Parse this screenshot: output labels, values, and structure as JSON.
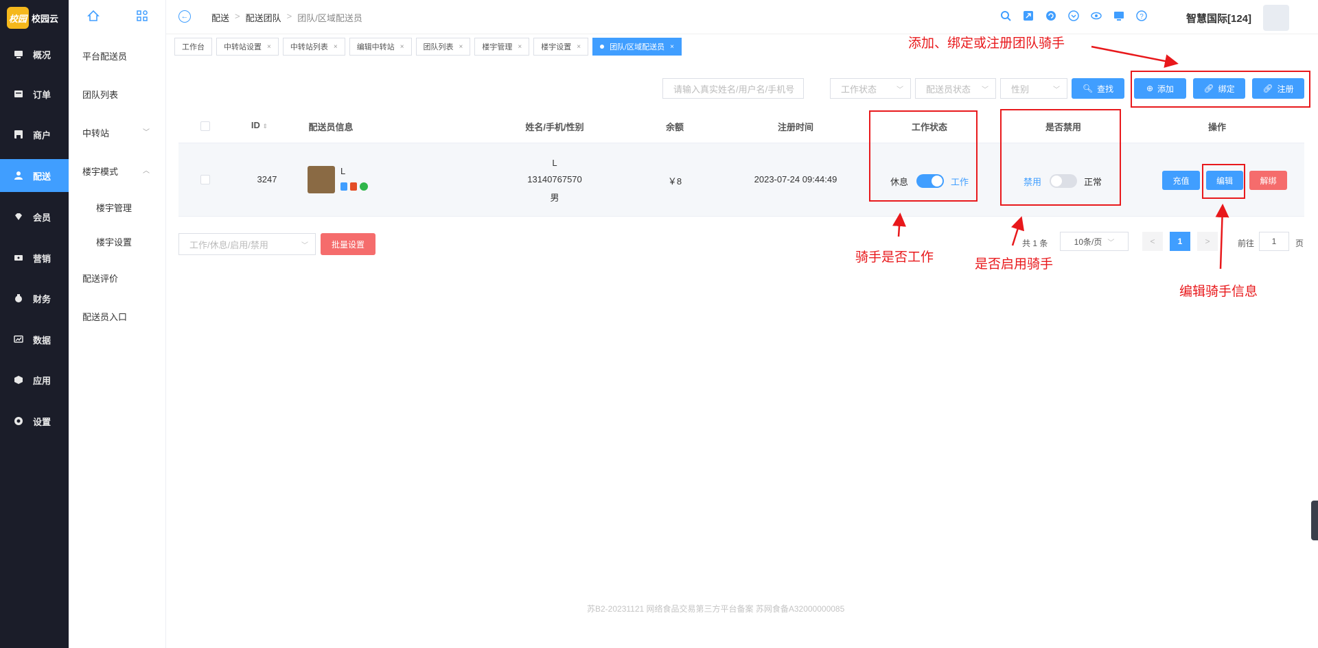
{
  "app": {
    "logo_badge": "校园",
    "logo_name": "校园云",
    "accent": "#409eff",
    "danger": "#f56c6c",
    "annotation_color": "#e8181b"
  },
  "sidebar": {
    "items": [
      {
        "label": "概况",
        "icon": "monitor-icon"
      },
      {
        "label": "订单",
        "icon": "order-icon"
      },
      {
        "label": "商户",
        "icon": "store-icon"
      },
      {
        "label": "配送",
        "icon": "rider-icon",
        "active": true
      },
      {
        "label": "会员",
        "icon": "diamond-icon"
      },
      {
        "label": "营销",
        "icon": "ticket-icon"
      },
      {
        "label": "财务",
        "icon": "money-bag-icon"
      },
      {
        "label": "数据",
        "icon": "chart-icon"
      },
      {
        "label": "应用",
        "icon": "cube-icon"
      },
      {
        "label": "设置",
        "icon": "settings-icon"
      }
    ]
  },
  "submenu": {
    "items": [
      "平台配送员",
      "团队列表",
      "中转站",
      "楼宇模式",
      "楼宇管理",
      "楼宇设置",
      "配送评价",
      "配送员入口"
    ]
  },
  "header": {
    "breadcrumb": [
      "配送",
      "配送团队",
      "团队/区域配送员"
    ],
    "org_name": "智慧国际[124]"
  },
  "tabs": [
    "工作台",
    "中转站设置",
    "中转站列表",
    "编辑中转站",
    "团队列表",
    "楼宇管理",
    "楼宇设置",
    "团队/区域配送员"
  ],
  "filters": {
    "search_placeholder": "请输入真实姓名/用户名/手机号",
    "work_status": "工作状态",
    "rider_status": "配送员状态",
    "gender": "性别",
    "search_btn": "查找",
    "add_btn": "添加",
    "bind_btn": "绑定",
    "register_btn": "注册"
  },
  "table": {
    "headers": {
      "id": "ID",
      "info": "配送员信息",
      "name": "姓名/手机/性别",
      "balance": "余额",
      "reg_time": "注册时间",
      "work_status": "工作状态",
      "disabled": "是否禁用",
      "ops": "操作"
    },
    "row": {
      "id": "3247",
      "nick": "L",
      "name": "L",
      "phone": "13140767570",
      "gender": "男",
      "balance": "￥8",
      "reg_time": "2023-07-24 09:44:49",
      "work_off_label": "休息",
      "work_on_label": "工作",
      "work_on": true,
      "disable_label": "禁用",
      "normal_label": "正常",
      "disabled": false,
      "recharge_btn": "充值",
      "edit_btn": "编辑",
      "unbind_btn": "解绑"
    }
  },
  "batch": {
    "placeholder": "工作/休息/启用/禁用",
    "btn": "批量设置"
  },
  "pagination": {
    "total": "共 1 条",
    "page_size": "10条/页",
    "current": "1",
    "goto_label": "前往",
    "goto_value": "1",
    "page_suffix": "页"
  },
  "annotations": {
    "top": "添加、绑定或注册团队骑手",
    "work": "骑手是否工作",
    "enable": "是否启用骑手",
    "edit": "编辑骑手信息"
  },
  "footer": "苏B2-20231121  网络食品交易第三方平台备案 苏网食备A32000000085"
}
